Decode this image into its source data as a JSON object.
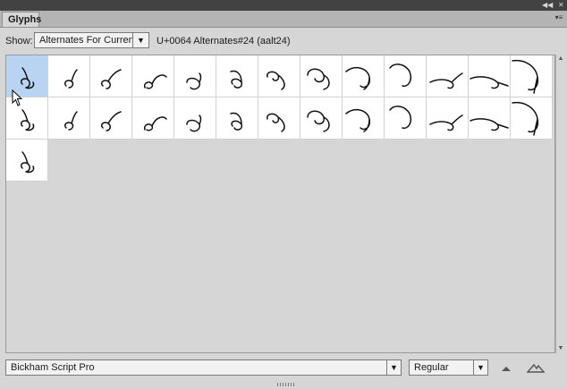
{
  "panel": {
    "tab_label": "Glyphs",
    "collapse_icon": "double-chevron-left",
    "menu_icon": "panel-menu"
  },
  "toolbar": {
    "show_label": "Show:",
    "show_value": "Alternates For Curren...",
    "unicode_info": "U+0064 Alternates#24 (aalt24)"
  },
  "glyphs": {
    "selected_index": 0,
    "count": 27,
    "columns": 13
  },
  "footer": {
    "font_family": "Bickham Script Pro",
    "font_style": "Regular",
    "zoom_out_icon": "small-mountain",
    "zoom_in_icon": "large-mountain"
  }
}
